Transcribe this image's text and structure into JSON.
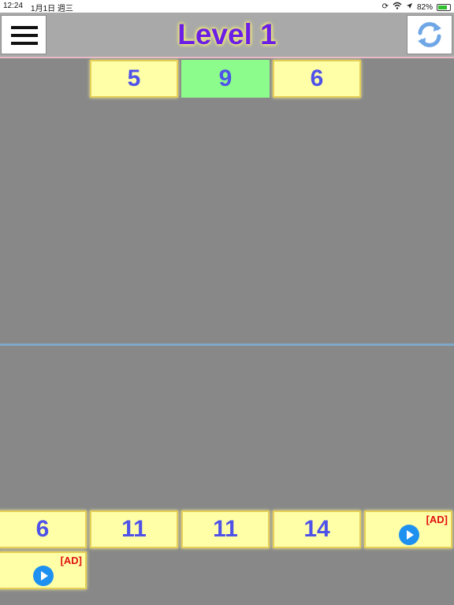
{
  "status_bar": {
    "time": "12:24",
    "date": "1月1日 週三",
    "battery": "82%",
    "battery_level": 0.82
  },
  "header": {
    "title": "Level 1"
  },
  "target_tiles": [
    "5",
    "9",
    "6"
  ],
  "selected_target_index": 1,
  "hand_tiles": [
    "6",
    "11",
    "11",
    "14"
  ],
  "ad_label": "[AD]",
  "colors": {
    "background": "#888888",
    "tile": "#ffffa8",
    "tile_selected": "#8cfc8c",
    "number_text": "#4f52e8",
    "title_text": "#6a1ee6",
    "ad_text": "#e01010"
  }
}
